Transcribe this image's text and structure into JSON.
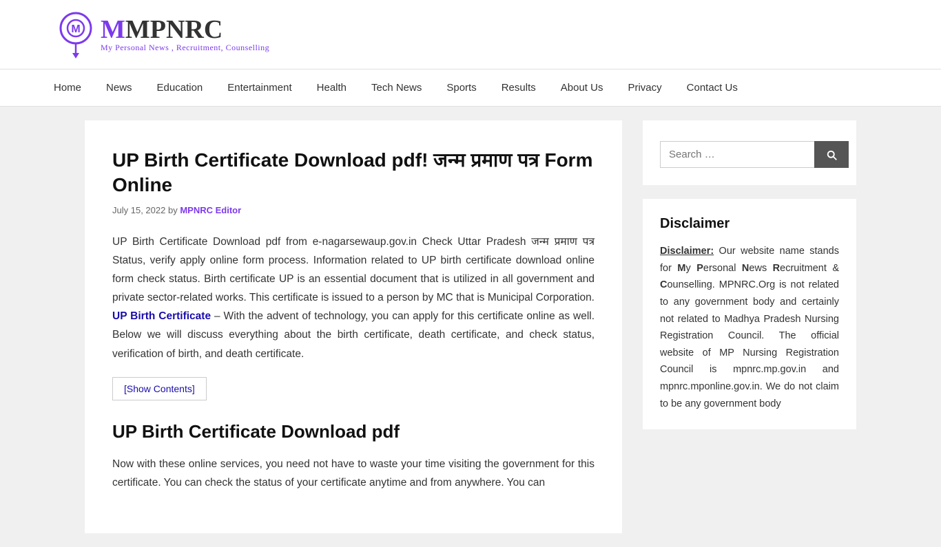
{
  "site": {
    "logo_m": "M",
    "logo_rest": "MPNRC",
    "logo_subtitle": "My Personal News , Recruitment, Counselling"
  },
  "nav": {
    "items": [
      {
        "label": "Home",
        "href": "#"
      },
      {
        "label": "News",
        "href": "#"
      },
      {
        "label": "Education",
        "href": "#"
      },
      {
        "label": "Entertainment",
        "href": "#"
      },
      {
        "label": "Health",
        "href": "#"
      },
      {
        "label": "Tech News",
        "href": "#"
      },
      {
        "label": "Sports",
        "href": "#"
      },
      {
        "label": "Results",
        "href": "#"
      },
      {
        "label": "About Us",
        "href": "#"
      },
      {
        "label": "Privacy",
        "href": "#"
      },
      {
        "label": "Contact Us",
        "href": "#"
      }
    ]
  },
  "article": {
    "title": "UP Birth Certificate Download pdf! जन्म प्रमाण पत्र Form Online",
    "date": "July 15, 2022",
    "by": "by",
    "author": "MPNRC Editor",
    "intro": "UP Birth Certificate Download pdf from e-nagarsewaup.gov.in Check Uttar Pradesh जन्म प्रमाण पत्र Status, verify apply online form process. Information related to UP birth certificate download online form check status. Birth certificate UP is an essential document that is utilized in all government and private sector-related works. This certificate is issued to a person by MC that is Municipal Corporation.",
    "link_text": "UP Birth Certificate",
    "intro_cont": " – With the advent of technology, you can apply for this certificate online as well. Below we will discuss everything about the birth certificate, death certificate, and check status, verification of birth, and death certificate.",
    "show_contents": "[Show Contents]",
    "section_title": "UP Birth Certificate Download pdf",
    "section_body": "Now with these online services, you need not have to waste your time visiting the government for this certificate. You can check the status of your certificate anytime and from anywhere. You can"
  },
  "sidebar": {
    "search_placeholder": "Search …",
    "search_label": "Search",
    "disclaimer_title": "Disclaimer",
    "disclaimer_text": "Our website name stands for My Personal News Recruitment & Counselling. MPNRC.Org is not related to any government body and certainly not related to Madhya Pradesh Nursing Registration Council. The official website of MP Nursing Registration Council is mpnrc.mp.gov.in and mpnrc.mponline.gov.in. We do not claim to be any government body"
  }
}
